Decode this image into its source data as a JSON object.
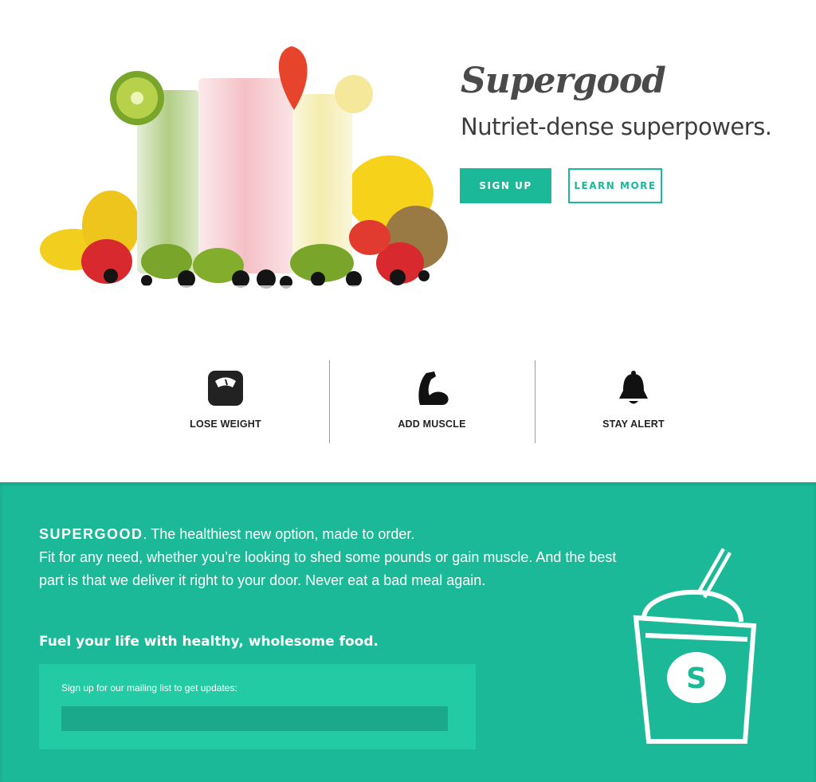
{
  "hero": {
    "brand": "Supergood",
    "tagline": "Nutriet-dense superpowers.",
    "signup_label": "SIGN UP",
    "learn_more_label": "LEARN MORE"
  },
  "features": [
    {
      "label": "LOSE WEIGHT",
      "icon": "scale-icon"
    },
    {
      "label": "ADD MUSCLE",
      "icon": "flexed-arm-icon"
    },
    {
      "label": "STAY ALERT",
      "icon": "bell-icon"
    }
  ],
  "about": {
    "brand_caps": "SUPERGOOD",
    "line1": ". The healthiest new option, made to order.",
    "body": "Fit for any need, whether you’re looking to shed some pounds or gain muscle. And the best part is that we deliver it right to your door. Never eat a bad meal again.",
    "fuel_heading": "Fuel your life with healthy, wholesome food.",
    "mailing_label": "Sign up for our mailing list to get updates:",
    "mailing_value": "",
    "cup_letter": "S"
  },
  "colors": {
    "accent": "#1bb997",
    "accent_light": "#22cba3",
    "accent_dark": "#1aa98a"
  }
}
